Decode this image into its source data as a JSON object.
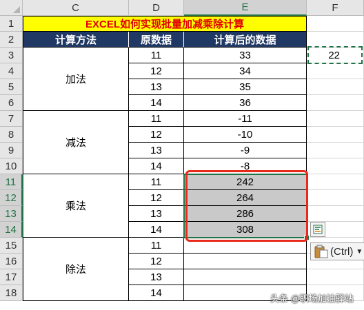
{
  "column_headers": [
    "C",
    "D",
    "E",
    "F"
  ],
  "row_headers": [
    "1",
    "2",
    "3",
    "4",
    "5",
    "6",
    "7",
    "8",
    "9",
    "10",
    "11",
    "12",
    "13",
    "14",
    "15",
    "16",
    "17",
    "18"
  ],
  "title": "EXCEL如何实现批量加减乘除计算",
  "table_headers": [
    "计算方法",
    "原数据",
    "计算后的数据"
  ],
  "groups": [
    {
      "method": "加法",
      "rows": [
        {
          "original": "11",
          "result": "33"
        },
        {
          "original": "12",
          "result": "34"
        },
        {
          "original": "13",
          "result": "35"
        },
        {
          "original": "14",
          "result": "36"
        }
      ]
    },
    {
      "method": "减法",
      "rows": [
        {
          "original": "11",
          "result": "-11"
        },
        {
          "original": "12",
          "result": "-10"
        },
        {
          "original": "13",
          "result": "-9"
        },
        {
          "original": "14",
          "result": "-8"
        }
      ]
    },
    {
      "method": "乘法",
      "rows": [
        {
          "original": "11",
          "result": "242"
        },
        {
          "original": "12",
          "result": "264"
        },
        {
          "original": "13",
          "result": "286"
        },
        {
          "original": "14",
          "result": "308"
        }
      ]
    },
    {
      "method": "除法",
      "rows": [
        {
          "original": "11",
          "result": ""
        },
        {
          "original": "12",
          "result": ""
        },
        {
          "original": "13",
          "result": ""
        },
        {
          "original": "14",
          "result": ""
        }
      ]
    }
  ],
  "copied_cell_value": "22",
  "paste_options_label": "(Ctrl)",
  "watermark": "头条 @职场加油驿站",
  "colors": {
    "title_fill": "#ffff00",
    "title_text": "#e00000",
    "header_fill": "#203864",
    "selection": "#217346",
    "highlight_box": "#e8291c",
    "selected_fill": "#c9c9c9"
  }
}
